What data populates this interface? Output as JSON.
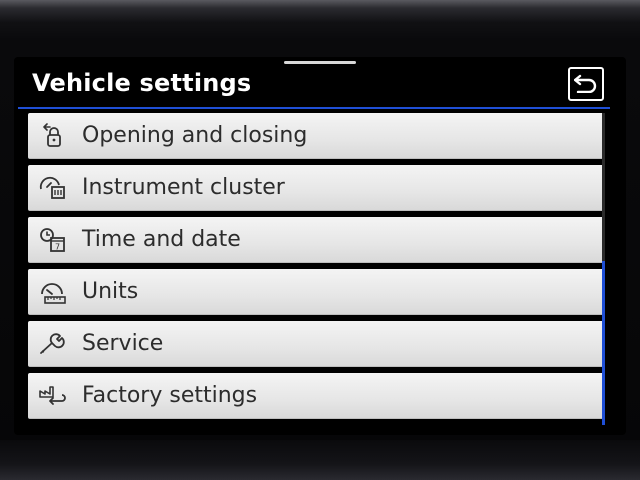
{
  "header": {
    "title": "Vehicle settings",
    "back_icon": "back-arrow-icon"
  },
  "menu": {
    "items": [
      {
        "label": "Opening and closing",
        "icon": "door-lock-icon"
      },
      {
        "label": "Instrument cluster",
        "icon": "gauge-display-icon"
      },
      {
        "label": "Time and date",
        "icon": "clock-calendar-icon"
      },
      {
        "label": "Units",
        "icon": "speedometer-ruler-icon"
      },
      {
        "label": "Service",
        "icon": "wrench-icon"
      },
      {
        "label": "Factory settings",
        "icon": "factory-reset-icon"
      }
    ]
  },
  "colors": {
    "accent": "#1f4fd6",
    "item_bg": "#e6e6e6",
    "item_text": "#2c2c2c",
    "title_text": "#ffffff"
  }
}
